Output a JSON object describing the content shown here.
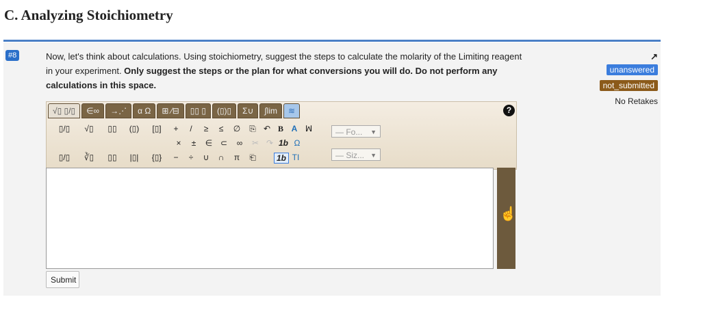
{
  "page": {
    "title": "C. Analyzing Stoichiometry"
  },
  "question": {
    "number": "#8",
    "text_part1": "Now, let's think about calculations. Using stoichiometry, suggest the steps to calculate the molarity of the Limiting reagent in your experiment. ",
    "text_bold": "Only suggest the steps or the plan for what conversions you will do. Do not perform any calculations in this space."
  },
  "status": {
    "badge1": "unanswered",
    "badge2": "not_submitted",
    "retakes": "No Retakes"
  },
  "editor": {
    "tabs": [
      "√▯ ▯/▯",
      "∈∞",
      "→⋰",
      "α Ω",
      "⊞ ⁄⊟",
      "▯▯ ▯",
      "(▯)▯",
      "Σ∪",
      "∫lim",
      "≋"
    ],
    "row1": [
      "▯/▯",
      "√▯",
      "▯▯",
      "(▯)",
      "[▯]",
      "+",
      "/",
      "≥",
      "≤",
      "∅",
      "⎘",
      "↶",
      "B",
      "A",
      "ꟽ"
    ],
    "row2": [
      "×",
      "±",
      "∈",
      "⊂",
      "∞",
      "✂",
      "↷",
      "1b",
      "Ω"
    ],
    "row3": [
      "▯/▯",
      "∛▯",
      "▯▯",
      "|▯|",
      "{▯}",
      "−",
      "÷",
      "∪",
      "∩",
      "π",
      "⎗",
      "1b",
      "TI"
    ],
    "font_select": "— Fo...",
    "size_select": "— Siz..."
  },
  "submit_label": "Submit"
}
